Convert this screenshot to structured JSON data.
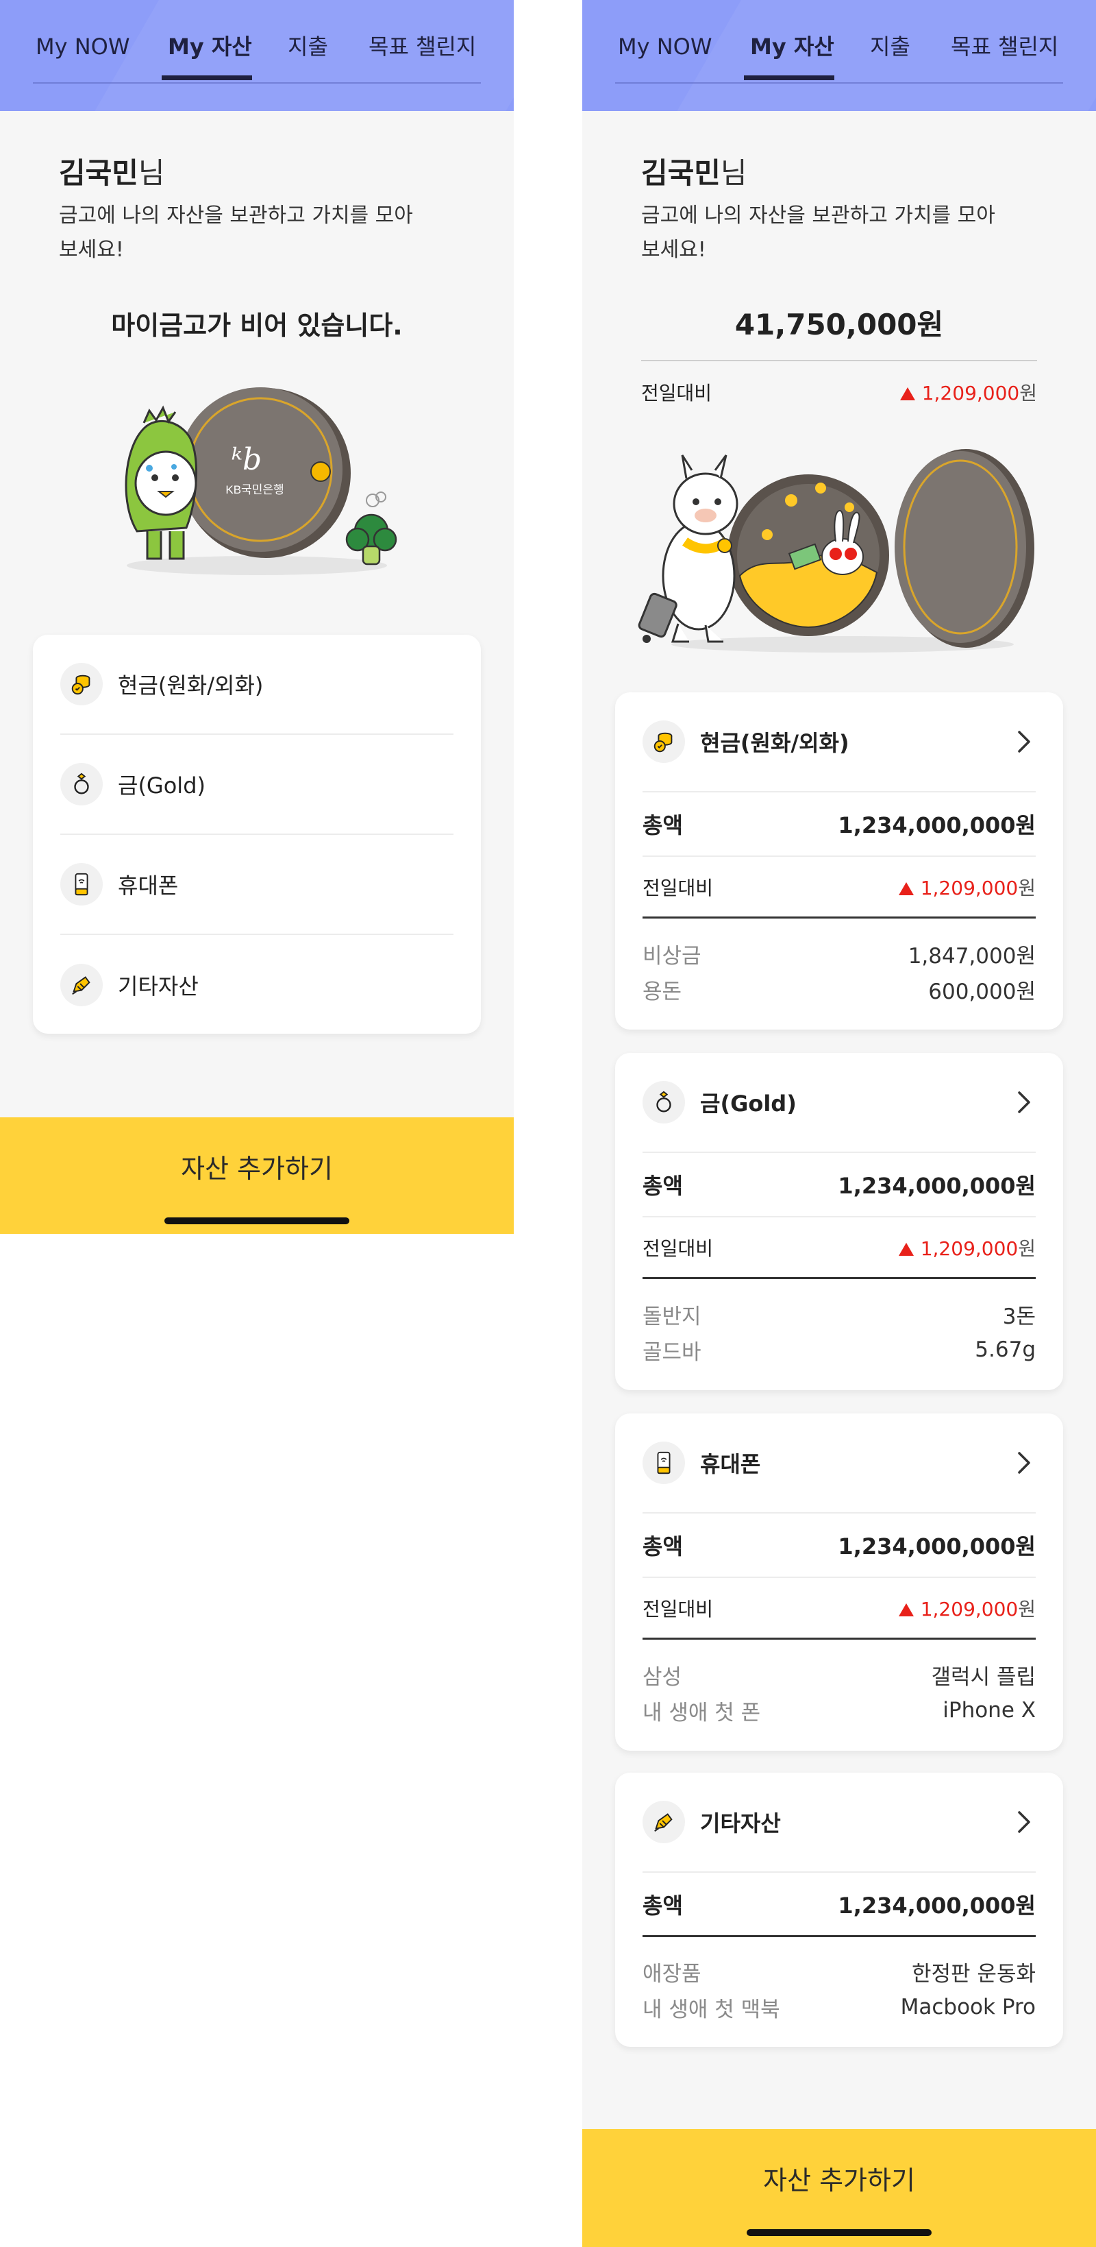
{
  "tabs": [
    "My NOW",
    "My 자산",
    "지출",
    "목표 챌린지"
  ],
  "active_tab": "My 자산",
  "user": {
    "name": "김국민",
    "suffix": "님"
  },
  "greeting_message": "금고에 나의 자산을 보관하고 가치를 모아보세요!",
  "empty_state": {
    "message": "마이금고가 비어 있습니다.",
    "vault_logo": "KB국민은행",
    "categories": [
      {
        "label": "현금(원화/외화)",
        "icon": "cash-coins-icon"
      },
      {
        "label": "금(Gold)",
        "icon": "gold-ring-icon"
      },
      {
        "label": "휴대폰",
        "icon": "phone-icon"
      },
      {
        "label": "기타자산",
        "icon": "other-asset-icon"
      }
    ]
  },
  "summary": {
    "total": "41,750,000원",
    "compare_label": "전일대비",
    "change_amount": "1,209,000",
    "change_unit": "원"
  },
  "asset_cards": [
    {
      "label": "현금(원화/외화)",
      "icon": "cash-coins-icon",
      "total_label": "총액",
      "total": "1,234,000,000원",
      "compare_label": "전일대비",
      "change_amount": "1,209,000",
      "change_unit": "원",
      "details": [
        {
          "label": "비상금",
          "value": "1,847,000원"
        },
        {
          "label": "용돈",
          "value": "600,000원"
        }
      ]
    },
    {
      "label": "금(Gold)",
      "icon": "gold-ring-icon",
      "total_label": "총액",
      "total": "1,234,000,000원",
      "compare_label": "전일대비",
      "change_amount": "1,209,000",
      "change_unit": "원",
      "details": [
        {
          "label": "돌반지",
          "value": "3돈"
        },
        {
          "label": "골드바",
          "value": "5.67g"
        }
      ]
    },
    {
      "label": "휴대폰",
      "icon": "phone-icon",
      "total_label": "총액",
      "total": "1,234,000,000원",
      "compare_label": "전일대비",
      "change_amount": "1,209,000",
      "change_unit": "원",
      "details": [
        {
          "label": "삼성",
          "value": "갤럭시 플립"
        },
        {
          "label": "내 생애 첫 폰",
          "value": "iPhone X"
        }
      ]
    },
    {
      "label": "기타자산",
      "icon": "other-asset-icon",
      "total_label": "총액",
      "total": "1,234,000,000원",
      "details": [
        {
          "label": "애장품",
          "value": "한정판 운동화"
        },
        {
          "label": "내 생애 첫 맥북",
          "value": "Macbook Pro"
        }
      ]
    }
  ],
  "cta_label": "자산 추가하기",
  "colors": {
    "header": "#8d9df9",
    "cta": "#ffd23a",
    "increase": "#e8211a",
    "character_green": "#8cc63f"
  }
}
